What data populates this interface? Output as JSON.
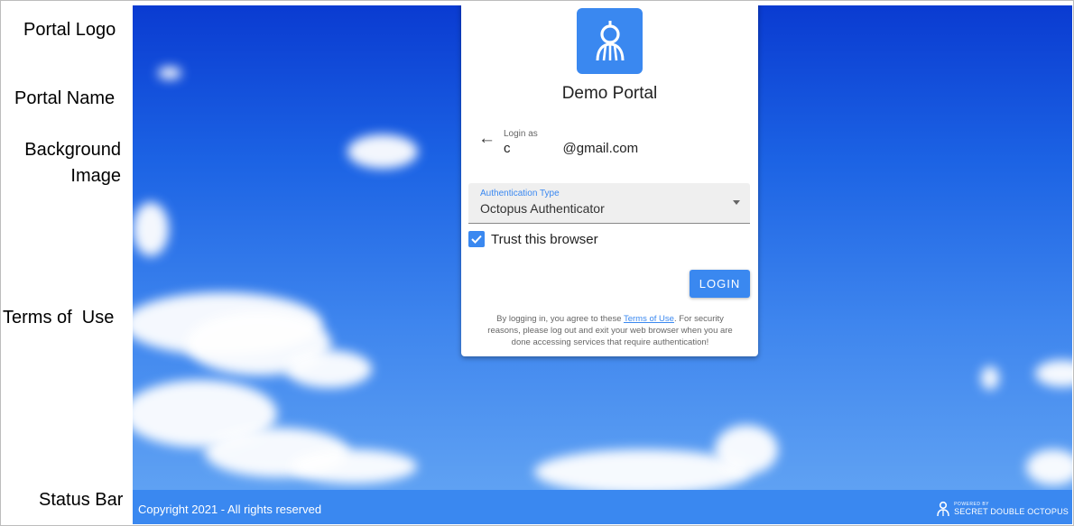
{
  "callouts": {
    "portal_logo": "Portal Logo",
    "portal_name": "Portal Name",
    "background_image_line1": "Background",
    "background_image_line2": "Image",
    "terms_of_use": "Terms of  Use",
    "status_bar": "Status Bar"
  },
  "portal": {
    "logo_icon": "octopus-logo-icon",
    "name": "Demo Portal"
  },
  "login": {
    "back_icon": "arrow-left-icon",
    "login_as_label": "Login as",
    "email_prefix": "c",
    "email_suffix": "@gmail.com",
    "auth_type_label": "Authentication Type",
    "auth_type_value": "Octopus Authenticator",
    "trust_label": "Trust this browser",
    "trust_checked": true,
    "login_button": "LOGIN"
  },
  "terms": {
    "prefix": "By logging in, you agree to these ",
    "link": "Terms of Use",
    "suffix": ". For security reasons, please log out and exit your web browser when you are done accessing services that require authentication!"
  },
  "status_bar": {
    "copyright": "Copyright 2021 - All rights reserved",
    "powered_by": "POWERED BY",
    "brand": "SECRET DOUBLE OCTOPUS"
  },
  "colors": {
    "accent": "#3a88f0",
    "sky_top": "#0a3bd1",
    "sky_bottom": "#66a7f4"
  }
}
